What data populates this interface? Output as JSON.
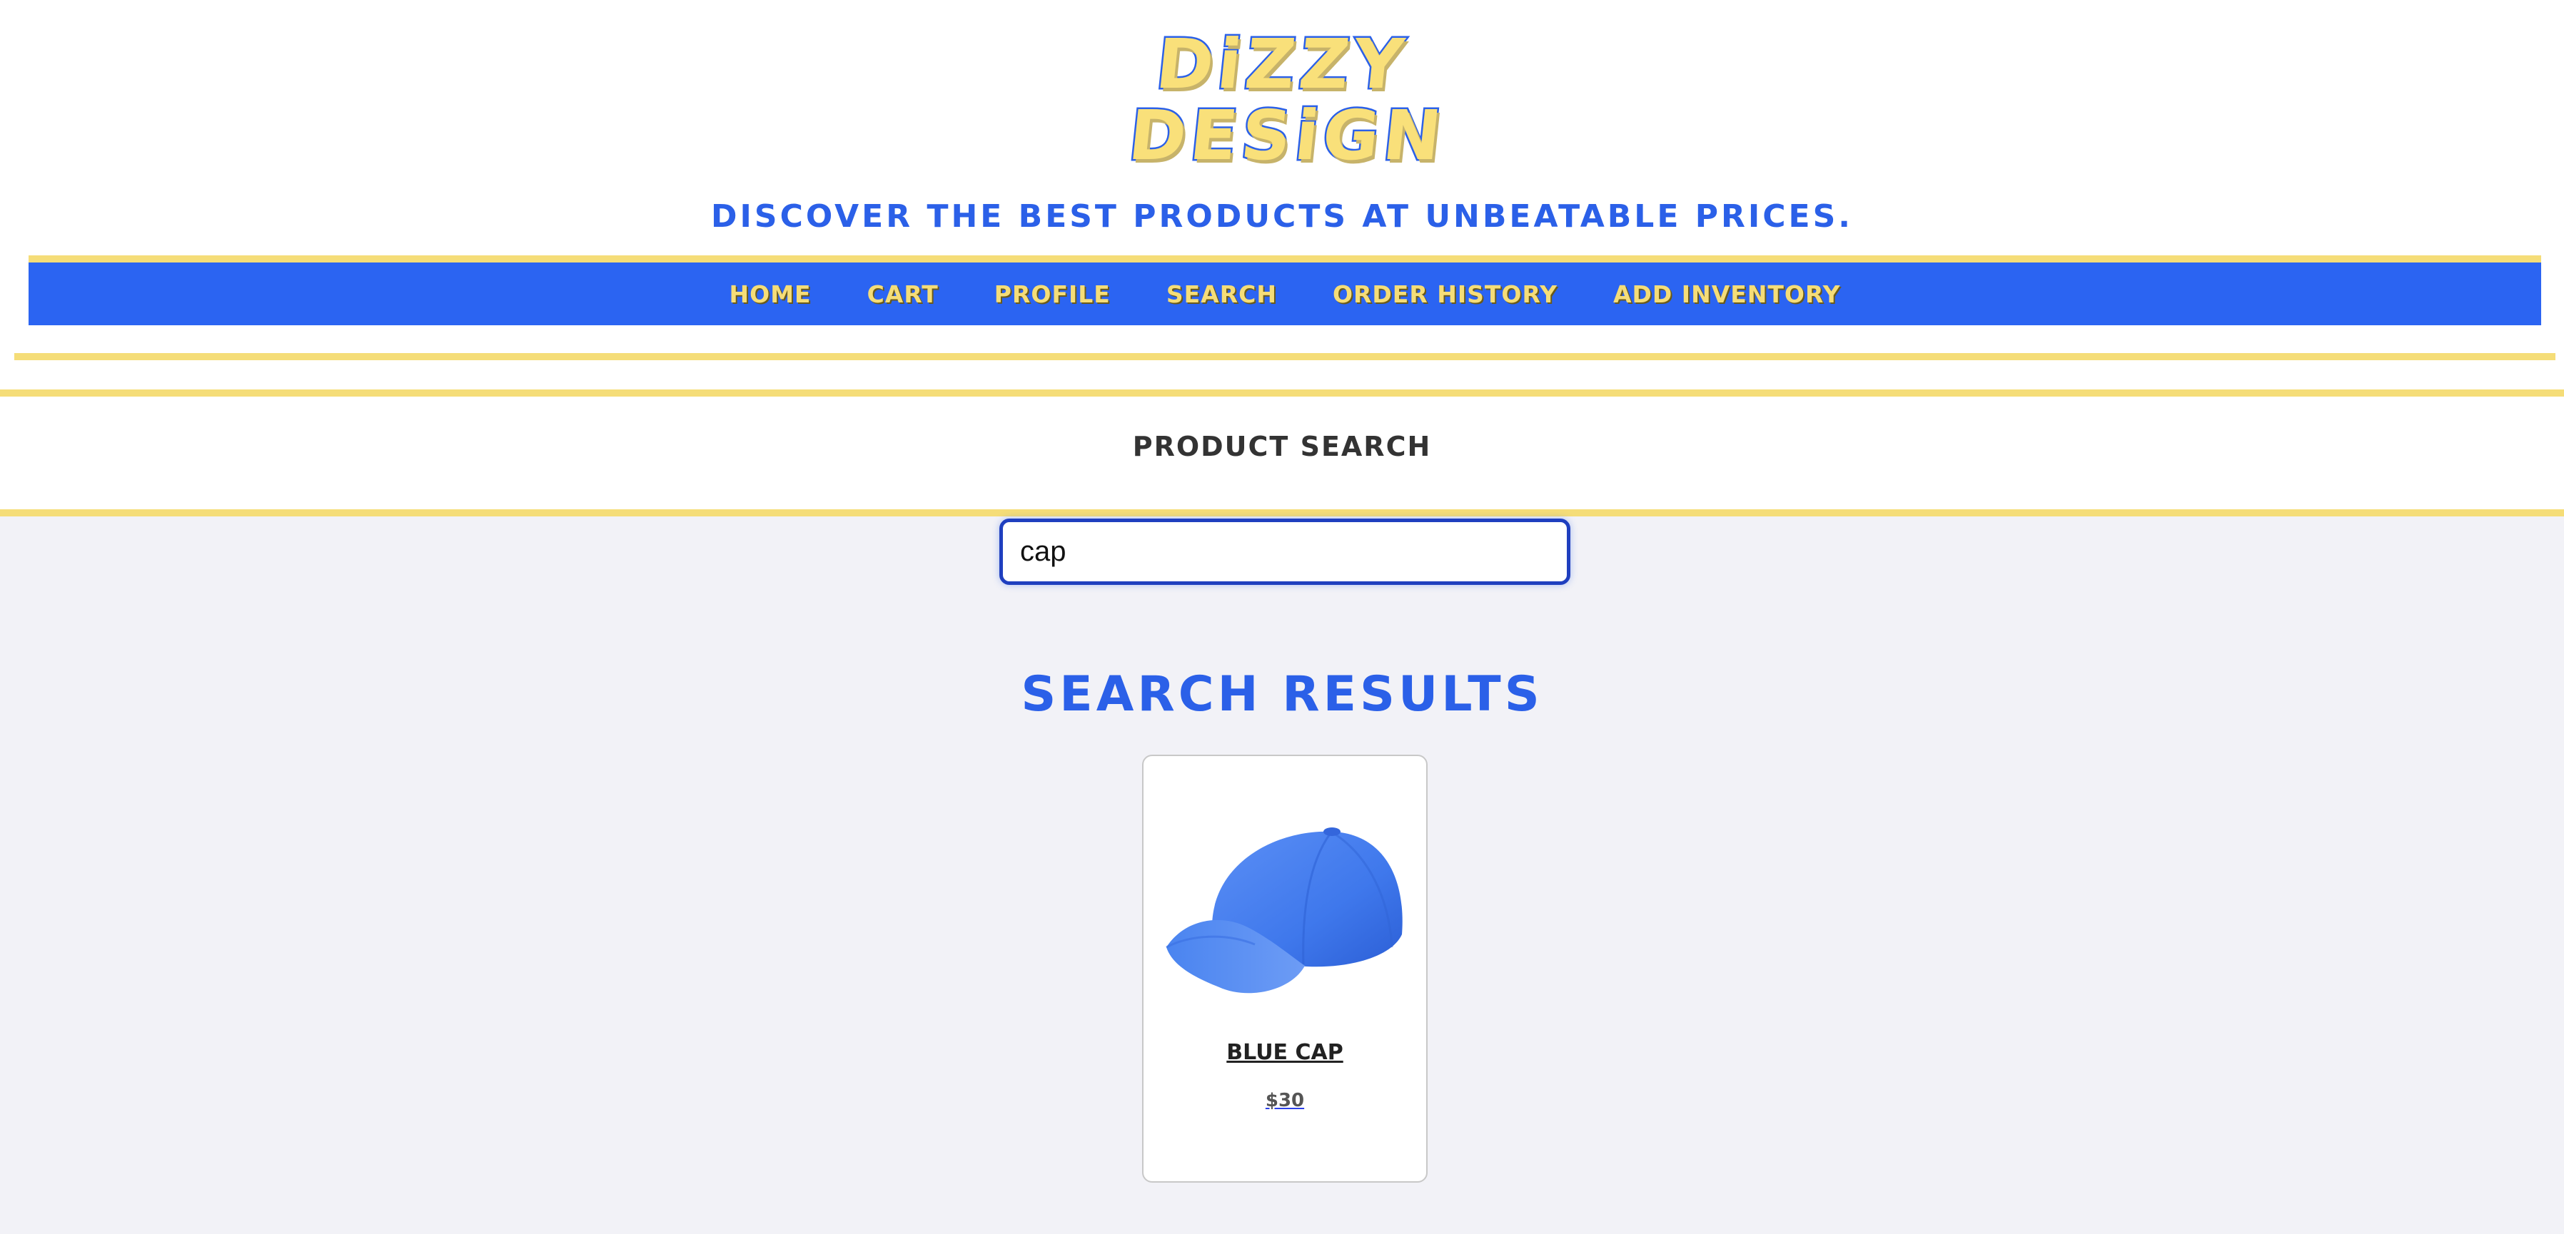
{
  "brand": {
    "logo_line1": "DiZZY",
    "logo_line2": "DESiGN",
    "tagline": "Discover the best products at unbeatable prices."
  },
  "nav": {
    "items": [
      {
        "label": "Home"
      },
      {
        "label": "Cart"
      },
      {
        "label": "Profile"
      },
      {
        "label": "Search"
      },
      {
        "label": "Order History"
      },
      {
        "label": "Add Inventory"
      }
    ]
  },
  "search": {
    "heading": "Product Search",
    "value": "cap",
    "results_heading": "Search Results"
  },
  "results": [
    {
      "name": "Blue Cap",
      "price": "$30",
      "icon": "cap-image"
    }
  ],
  "colors": {
    "accent_blue": "#2b64f2",
    "accent_yellow": "#f5dd78",
    "page_bg": "#f2f2f7"
  }
}
